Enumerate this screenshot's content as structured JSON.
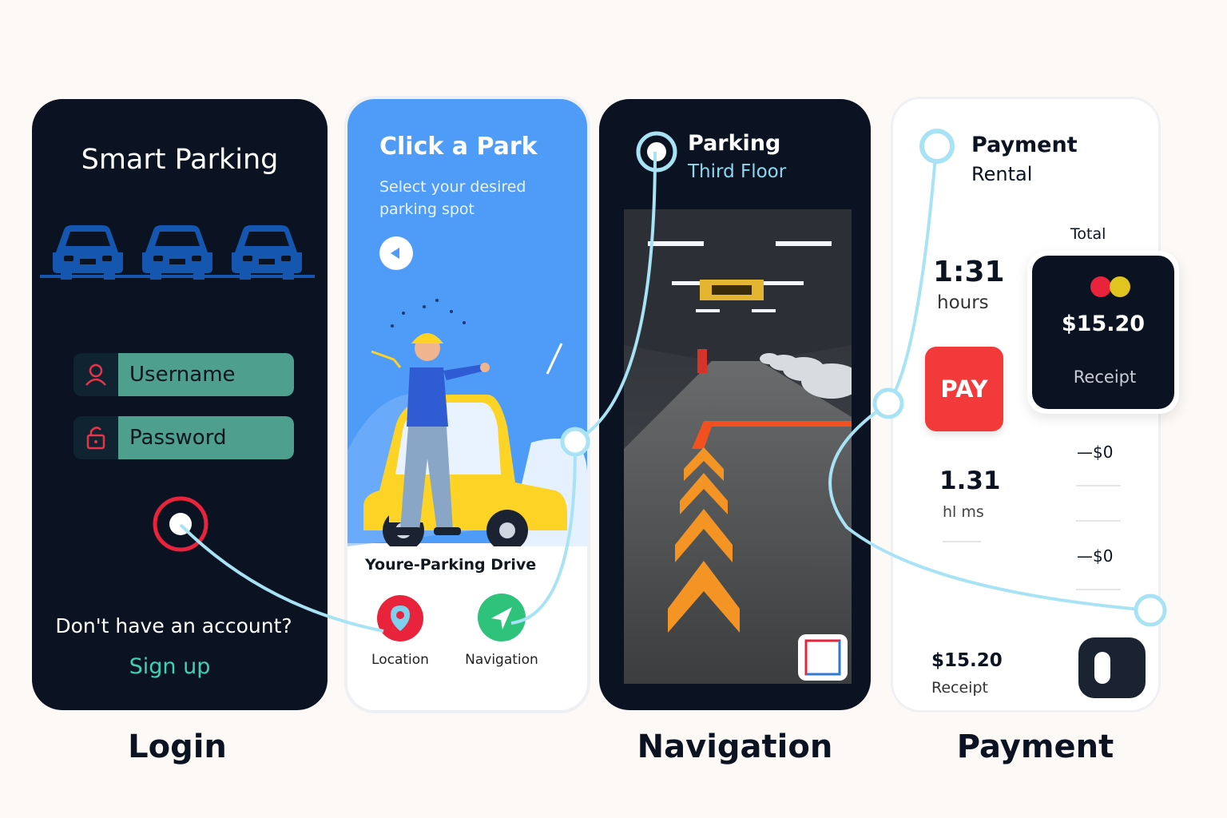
{
  "login": {
    "title": "Smart Parking",
    "username_placeholder": "Username",
    "password_placeholder": "Password",
    "no_account": "Don't have an account?",
    "signup": "Sign up",
    "caption": "Login"
  },
  "park": {
    "title": "Click a Park",
    "subtitle": "Select your desired parking spot",
    "section": "Youre-Parking Drive",
    "actions": [
      {
        "label": "Location",
        "icon": "location-pin-icon"
      },
      {
        "label": "Navigation",
        "icon": "navigation-arrow-icon"
      }
    ]
  },
  "nav": {
    "title": "Parking",
    "floor": "Third Floor",
    "caption": "Navigation"
  },
  "payment": {
    "title": "Payment",
    "subtitle": "Rental",
    "total_label": "Total",
    "duration": "1:31",
    "duration_unit": "hours",
    "pay_button": "PAY",
    "total_amount": "$15.20",
    "receipt_label": "Receipt",
    "secondary_value": "1.31",
    "secondary_unit": "hl ms",
    "fee_1": "—$0",
    "fee_2": "—$0",
    "footer_amount": "$15.20",
    "footer_receipt": "Receipt",
    "caption": "Payment"
  },
  "colors": {
    "dark": "#0b1322",
    "teal_field": "#4f9f8e",
    "signup": "#3fd1b4",
    "blue": "#4f9cf8",
    "pay_red": "#f23a3a",
    "flow_line": "#a8e3f5",
    "arrow_orange": "#f39425"
  }
}
